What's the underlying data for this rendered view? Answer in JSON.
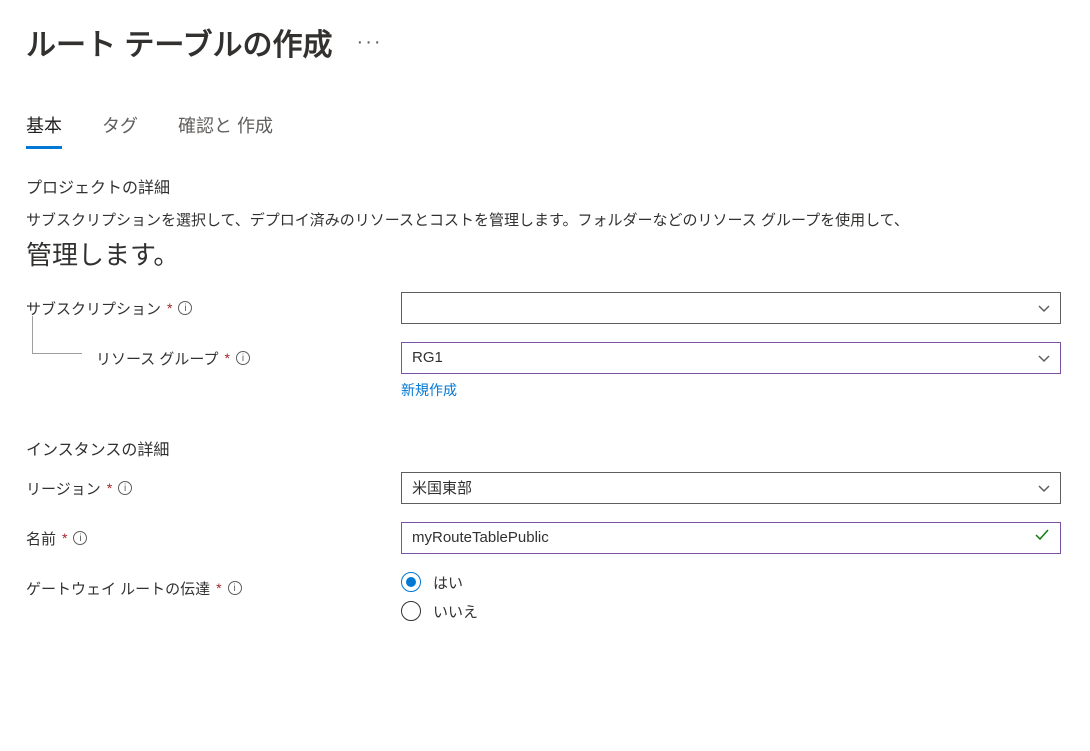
{
  "header": {
    "title": "ルート テーブルの作成"
  },
  "tabs": {
    "basic": "基本",
    "tags": "タグ",
    "review": "確認と 作成"
  },
  "sections": {
    "project": {
      "header": "プロジェクトの詳細",
      "description_line": "サブスクリプションを選択して、デプロイ済みのリソースとコストを管理します。フォルダーなどのリソース グループを使用して、",
      "description_big": "管理します。",
      "subscription_label": "サブスクリプション",
      "subscription_value": "",
      "resource_group_label": "リソース グループ",
      "resource_group_value": "RG1",
      "new_link": "新規作成"
    },
    "instance": {
      "header": "インスタンスの詳細",
      "region_label": "リージョン",
      "region_value": "米国東部",
      "name_label": "名前",
      "name_value": "myRouteTablePublic",
      "gateway_label": "ゲートウェイ ルートの伝達",
      "gateway_yes": "はい",
      "gateway_no": "いいえ"
    }
  },
  "symbols": {
    "required": "*",
    "info": "i"
  }
}
